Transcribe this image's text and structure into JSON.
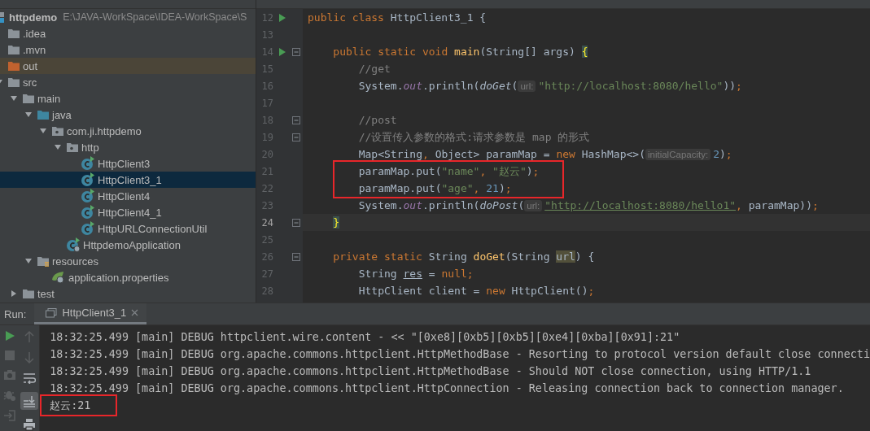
{
  "project_tree": {
    "items": [
      {
        "name": "httpdemo",
        "path": "E:\\JAVA-WorkSpace\\IDEA-WorkSpace\\S",
        "kind": "module",
        "selected": false,
        "children": [
          {
            "name": ".idea",
            "kind": "folder",
            "selected": false
          },
          {
            "name": ".mvn",
            "kind": "folder",
            "selected": false
          },
          {
            "name": "out",
            "kind": "excluded-folder",
            "selected": false
          },
          {
            "name": "src",
            "kind": "folder",
            "selected": false,
            "expanded": true,
            "children": [
              {
                "name": "main",
                "kind": "folder",
                "selected": false,
                "expanded": true,
                "children": [
                  {
                    "name": "java",
                    "kind": "source-folder",
                    "selected": false,
                    "expanded": true,
                    "children": [
                      {
                        "name": "com.ji.httpdemo",
                        "kind": "package",
                        "selected": false,
                        "expanded": true,
                        "children": [
                          {
                            "name": "http",
                            "kind": "package",
                            "selected": false,
                            "expanded": true,
                            "children": [
                              {
                                "name": "HttpClient3",
                                "kind": "class",
                                "selected": false
                              },
                              {
                                "name": "HttpClient3_1",
                                "kind": "class",
                                "selected": true
                              },
                              {
                                "name": "HttpClient4",
                                "kind": "class",
                                "selected": false
                              },
                              {
                                "name": "HttpClient4_1",
                                "kind": "class",
                                "selected": false
                              },
                              {
                                "name": "HttpURLConnectionUtil",
                                "kind": "class",
                                "selected": false
                              }
                            ]
                          },
                          {
                            "name": "HttpdemoApplication",
                            "kind": "spring-class",
                            "selected": false
                          }
                        ]
                      }
                    ]
                  },
                  {
                    "name": "resources",
                    "kind": "resources-folder",
                    "selected": false,
                    "expanded": true,
                    "children": [
                      {
                        "name": "application.properties",
                        "kind": "properties-file",
                        "selected": false
                      }
                    ]
                  }
                ]
              },
              {
                "name": "test",
                "kind": "folder",
                "selected": false,
                "expanded": false
              }
            ]
          }
        ]
      }
    ]
  },
  "editor": {
    "lines": [
      {
        "number": "12",
        "run": true,
        "fold": false,
        "current": false,
        "boxed": false,
        "kind": "class",
        "tokens": [
          {
            "kind": "kw",
            "text": "public class "
          },
          {
            "kind": "txt",
            "text": "HttpClient3_1 {"
          }
        ]
      },
      {
        "number": "13",
        "run": false,
        "fold": false,
        "current": false,
        "boxed": false
      },
      {
        "number": "14",
        "run": true,
        "fold": true,
        "current": false,
        "boxed": false,
        "kind": "member",
        "tokens": [
          {
            "kind": "kw",
            "text": "public static void "
          },
          {
            "kind": "fn",
            "text": "main"
          },
          {
            "kind": "txt",
            "text": "(String[] args) "
          },
          {
            "kind": "brace",
            "text": "{"
          }
        ]
      },
      {
        "number": "15",
        "run": false,
        "fold": false,
        "current": false,
        "boxed": false,
        "kind": "statement",
        "tokens": [
          {
            "kind": "cmt",
            "text": "//get"
          }
        ]
      },
      {
        "number": "16",
        "run": false,
        "fold": false,
        "current": false,
        "boxed": false,
        "kind": "statement",
        "tokens": [
          {
            "kind": "txt",
            "text": "System."
          },
          {
            "kind": "field",
            "text": "out"
          },
          {
            "kind": "txt",
            "text": ".println("
          },
          {
            "kind": "call",
            "text": "doGet"
          },
          {
            "kind": "txt",
            "text": "("
          },
          {
            "kind": "hint",
            "text": "url:"
          },
          {
            "kind": "str",
            "text": "\"http://localhost:8080/hello\""
          },
          {
            "kind": "txt",
            "text": "))"
          },
          {
            "kind": "punct",
            "text": ";"
          }
        ]
      },
      {
        "number": "17",
        "run": false,
        "fold": false,
        "current": false,
        "boxed": false
      },
      {
        "number": "18",
        "run": false,
        "fold": true,
        "current": false,
        "boxed": false,
        "kind": "statement",
        "tokens": [
          {
            "kind": "cmt",
            "text": "//post"
          }
        ]
      },
      {
        "number": "19",
        "run": false,
        "fold": true,
        "current": false,
        "boxed": false,
        "kind": "statement",
        "tokens": [
          {
            "kind": "cmt",
            "text": "//设置传入参数的格式:请求参数是 map 的形式"
          }
        ]
      },
      {
        "number": "20",
        "run": false,
        "fold": false,
        "current": false,
        "boxed": false,
        "kind": "statement",
        "tokens": [
          {
            "kind": "txt",
            "text": "Map<String"
          },
          {
            "kind": "punct",
            "text": ", "
          },
          {
            "kind": "txt",
            "text": "Object> paramMap = "
          },
          {
            "kind": "kw",
            "text": "new "
          },
          {
            "kind": "txt",
            "text": "HashMap<>("
          },
          {
            "kind": "hint",
            "text": "initialCapacity:"
          },
          {
            "kind": "num",
            "text": "2"
          },
          {
            "kind": "txt",
            "text": ")"
          },
          {
            "kind": "punct",
            "text": ";"
          }
        ]
      },
      {
        "number": "21",
        "run": false,
        "fold": false,
        "current": false,
        "boxed": true,
        "kind": "statement",
        "tokens": [
          {
            "kind": "txt",
            "text": "paramMap.put("
          },
          {
            "kind": "str",
            "text": "\"name\""
          },
          {
            "kind": "punct",
            "text": ", "
          },
          {
            "kind": "str",
            "text": "\"赵云\""
          },
          {
            "kind": "txt",
            "text": ")"
          },
          {
            "kind": "punct",
            "text": ";"
          }
        ]
      },
      {
        "number": "22",
        "run": false,
        "fold": false,
        "current": false,
        "boxed": true,
        "kind": "statement",
        "tokens": [
          {
            "kind": "txt",
            "text": "paramMap.put("
          },
          {
            "kind": "str",
            "text": "\"age\""
          },
          {
            "kind": "punct",
            "text": ", "
          },
          {
            "kind": "num",
            "text": "21"
          },
          {
            "kind": "txt",
            "text": ")"
          },
          {
            "kind": "punct",
            "text": ";"
          }
        ]
      },
      {
        "number": "23",
        "run": false,
        "fold": false,
        "current": false,
        "boxed": false,
        "kind": "statement",
        "tokens": [
          {
            "kind": "txt",
            "text": "System."
          },
          {
            "kind": "field",
            "text": "out"
          },
          {
            "kind": "txt",
            "text": ".println("
          },
          {
            "kind": "call",
            "text": "doPost"
          },
          {
            "kind": "txt",
            "text": "("
          },
          {
            "kind": "hint",
            "text": "url:"
          },
          {
            "kind": "link",
            "text": "\"http://localhost:8080/hello1\""
          },
          {
            "kind": "punct",
            "text": ", "
          },
          {
            "kind": "txt",
            "text": "paramMap))"
          },
          {
            "kind": "punct",
            "text": ";"
          }
        ]
      },
      {
        "number": "24",
        "run": false,
        "fold": true,
        "current": true,
        "boxed": false,
        "kind": "member",
        "tokens": [
          {
            "kind": "brace",
            "text": "}"
          }
        ]
      },
      {
        "number": "25",
        "run": false,
        "fold": false,
        "current": false,
        "boxed": false
      },
      {
        "number": "26",
        "run": false,
        "fold": true,
        "current": false,
        "boxed": false,
        "kind": "member",
        "tokens": [
          {
            "kind": "kw",
            "text": "private static "
          },
          {
            "kind": "txt",
            "text": "String "
          },
          {
            "kind": "fn",
            "text": "doGet"
          },
          {
            "kind": "txt",
            "text": "(String "
          },
          {
            "kind": "usage",
            "text": "url"
          },
          {
            "kind": "txt",
            "text": ") {"
          }
        ]
      },
      {
        "number": "27",
        "run": false,
        "fold": false,
        "current": false,
        "boxed": false,
        "kind": "statement",
        "tokens": [
          {
            "kind": "txt",
            "text": "String "
          },
          {
            "kind": "under",
            "text": "res"
          },
          {
            "kind": "txt",
            "text": " = "
          },
          {
            "kind": "kw",
            "text": "null"
          },
          {
            "kind": "punct",
            "text": ";"
          }
        ]
      },
      {
        "number": "28",
        "run": false,
        "fold": false,
        "current": false,
        "boxed": false,
        "kind": "statement",
        "tokens": [
          {
            "kind": "txt",
            "text": "HttpClient client = "
          },
          {
            "kind": "kw",
            "text": "new "
          },
          {
            "kind": "txt",
            "text": "HttpClient()"
          },
          {
            "kind": "punct",
            "text": ";"
          }
        ]
      }
    ]
  },
  "run_panel": {
    "label": "Run:",
    "tabs": [
      {
        "title": "HttpClient3_1",
        "selected": true
      }
    ],
    "scroll_to_end_on": true,
    "console": [
      {
        "text": "18:32:25.499 [main] DEBUG httpclient.wire.content - << \"[0xe8][0xb5][0xb5][0xe4][0xba][0x91]:21\"",
        "boxed": false
      },
      {
        "text": "18:32:25.499 [main] DEBUG org.apache.commons.httpclient.HttpMethodBase - Resorting to protocol version default close connecti",
        "boxed": false
      },
      {
        "text": "18:32:25.499 [main] DEBUG org.apache.commons.httpclient.HttpMethodBase - Should NOT close connection, using HTTP/1.1",
        "boxed": false
      },
      {
        "text": "18:32:25.499 [main] DEBUG org.apache.commons.httpclient.HttpConnection - Releasing connection back to connection manager.",
        "boxed": false
      },
      {
        "text": "赵云:21",
        "boxed": true
      }
    ]
  }
}
